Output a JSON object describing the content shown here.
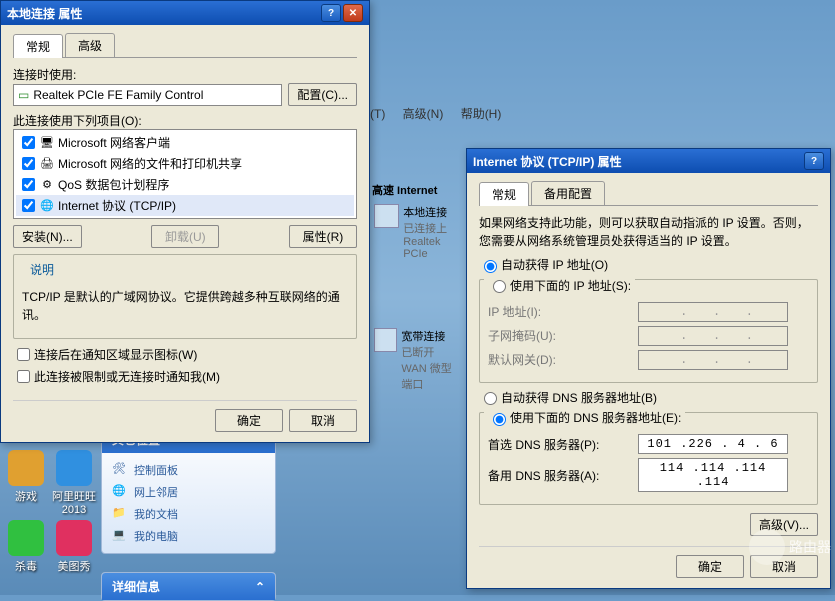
{
  "dialog1": {
    "title": "本地连接 属性",
    "tabs": [
      "常规",
      "高级"
    ],
    "connect_using_label": "连接时使用:",
    "adapter": "Realtek PCIe FE Family Control",
    "configure_btn": "配置(C)...",
    "items_label": "此连接使用下列项目(O):",
    "items": [
      {
        "checked": true,
        "icon": "client",
        "label": "Microsoft 网络客户端"
      },
      {
        "checked": true,
        "icon": "service",
        "label": "Microsoft 网络的文件和打印机共享"
      },
      {
        "checked": true,
        "icon": "qos",
        "label": "QoS 数据包计划程序"
      },
      {
        "checked": true,
        "icon": "protocol",
        "label": "Internet 协议 (TCP/IP)",
        "selected": true
      }
    ],
    "install_btn": "安装(N)...",
    "uninstall_btn": "卸载(U)",
    "properties_btn": "属性(R)",
    "desc_title": "说明",
    "desc_text": "TCP/IP 是默认的广域网协议。它提供跨越多种互联网络的通讯。",
    "notify_chk": "连接后在通知区域显示图标(W)",
    "limited_chk": "此连接被限制或无连接时通知我(M)",
    "ok_btn": "确定",
    "cancel_btn": "取消"
  },
  "dialog2": {
    "title": "Internet 协议 (TCP/IP) 属性",
    "tabs": [
      "常规",
      "备用配置"
    ],
    "intro": "如果网络支持此功能，则可以获取自动指派的 IP 设置。否则，您需要从网络系统管理员处获得适当的 IP 设置。",
    "ip_auto": "自动获得 IP 地址(O)",
    "ip_manual": "使用下面的 IP 地址(S):",
    "ip_label": "IP 地址(I):",
    "mask_label": "子网掩码(U):",
    "gateway_label": "默认网关(D):",
    "dns_auto": "自动获得 DNS 服务器地址(B)",
    "dns_manual": "使用下面的 DNS 服务器地址(E):",
    "dns1_label": "首选 DNS 服务器(P):",
    "dns1_val": "101 .226 . 4  . 6",
    "dns2_label": "备用 DNS 服务器(A):",
    "dns2_val": "114 .114 .114 .114",
    "advanced_btn": "高级(V)...",
    "ok_btn": "确定",
    "cancel_btn": "取消"
  },
  "menubar": {
    "items": [
      "(T)",
      "高级(N)",
      "帮助(H)"
    ]
  },
  "connections": {
    "header": "高速 Internet",
    "local": {
      "name": "本地连接",
      "status": "已连接上",
      "device": "Realtek PCIe"
    },
    "wan": {
      "name": "宽带连接",
      "status": "已断开",
      "device": "WAN 微型端口"
    }
  },
  "sidebar": {
    "title": "其它位置",
    "links": [
      "控制面板",
      "网上邻居",
      "我的文档",
      "我的电脑"
    ],
    "detail_title": "详细信息"
  },
  "desktop": {
    "icons": [
      {
        "label": "游戏",
        "color": "#e0a030"
      },
      {
        "label": "阿里旺旺2013",
        "color": "#3090e0"
      },
      {
        "label": "杀毒",
        "color": "#30c040"
      },
      {
        "label": "美图秀",
        "color": "#e03060"
      }
    ]
  },
  "watermark": "路由器"
}
